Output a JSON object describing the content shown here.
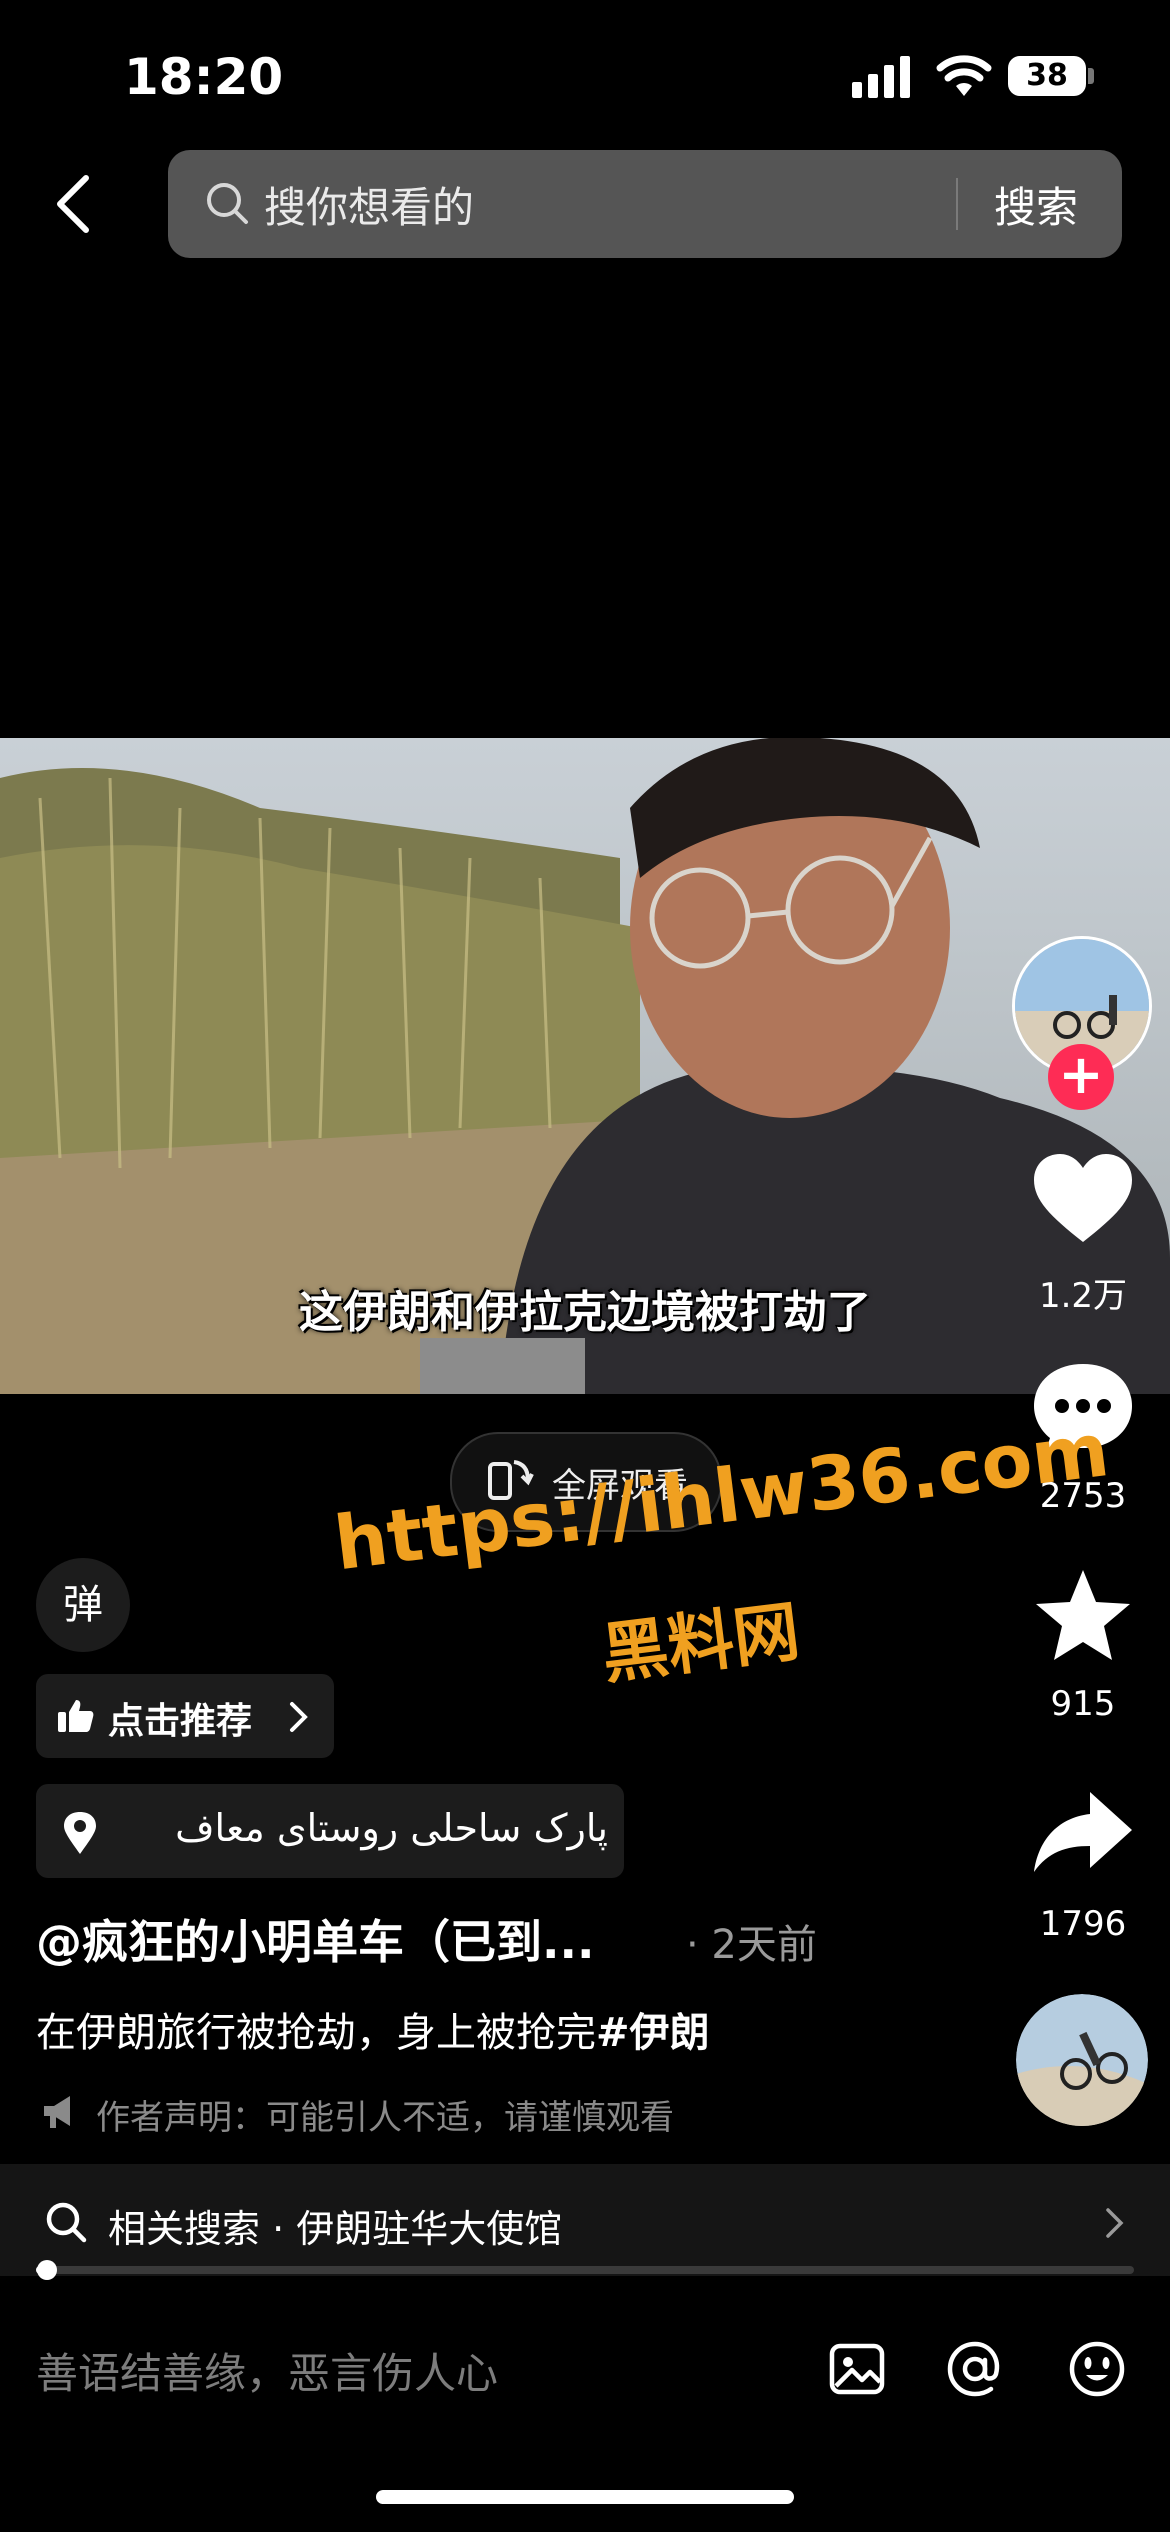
{
  "status": {
    "time": "18:20",
    "battery": "38"
  },
  "search": {
    "placeholder": "搜你想看的",
    "button": "搜索"
  },
  "video": {
    "subtitle": "这伊朗和伊拉克边境被打劫了"
  },
  "fullscreen": {
    "label": "全屏观看"
  },
  "rail": {
    "likes": "1.2万",
    "comments": "2753",
    "favorites": "915",
    "shares": "1796"
  },
  "danmu": {
    "label": "弹"
  },
  "watermark": {
    "url": "https://ihlw36.com",
    "name": "黑料网"
  },
  "recommend": {
    "label": "点击推荐"
  },
  "location": {
    "label": "پارک ساحلی روستای معاف"
  },
  "post": {
    "author": "@疯狂的小明单车（已到...",
    "time": "· 2天前",
    "text": "在伊朗旅行被抢劫，身上被抢完",
    "hashtag": "#伊朗",
    "warning": "作者声明：可能引人不适，请谨慎观看"
  },
  "related": {
    "label": "相关搜索 · 伊朗驻华大使馆"
  },
  "playback": {
    "progress": 0.01
  },
  "comment": {
    "placeholder": "善语结善缘，恶言伤人心"
  },
  "icons": [
    "back-icon",
    "search-icon",
    "fullscreen-icon",
    "heart-icon",
    "comment-icon",
    "star-icon",
    "share-icon",
    "thumb-up-icon",
    "location-pin-icon",
    "megaphone-icon",
    "image-icon",
    "at-icon",
    "emoji-icon"
  ],
  "colors": {
    "follow": "#fe2c55",
    "watermark": "#f0a020"
  }
}
